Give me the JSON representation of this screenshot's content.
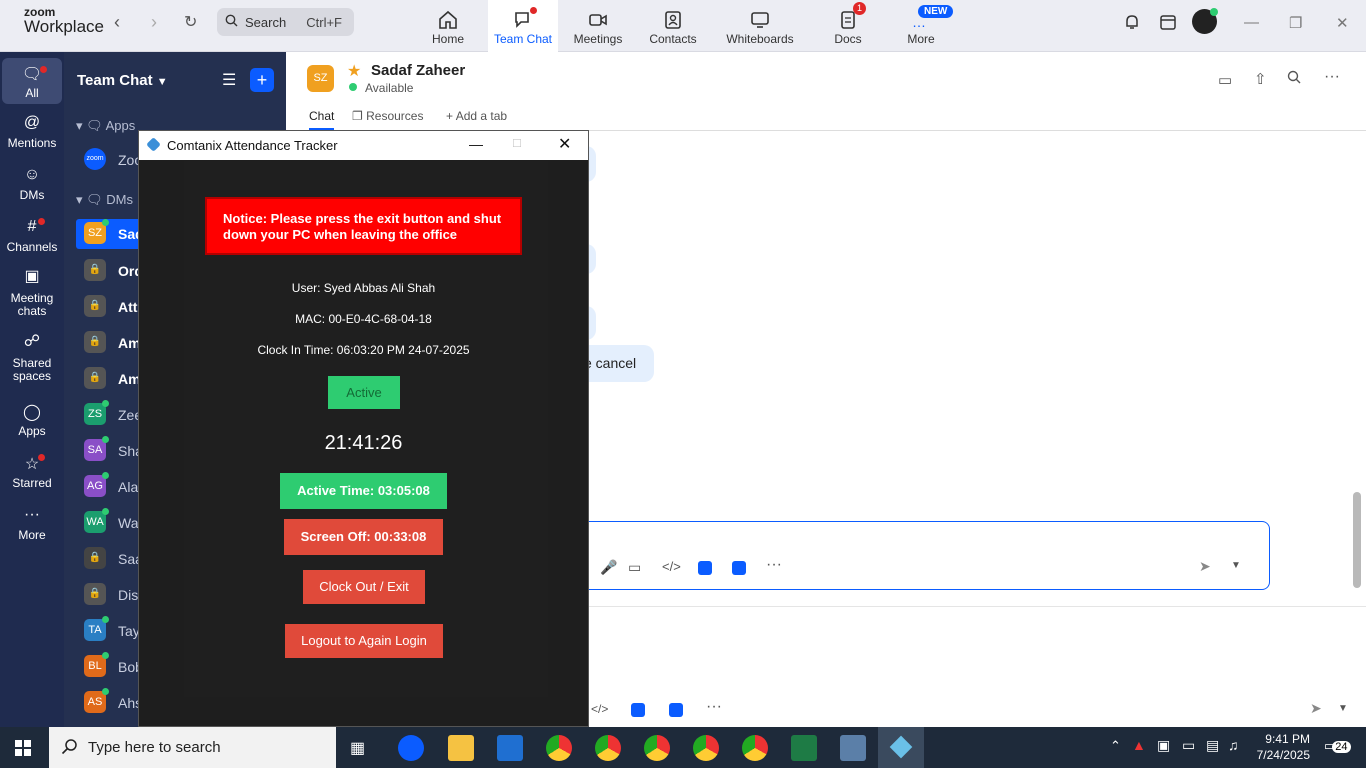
{
  "topbar": {
    "logo_line1": "zoom",
    "logo_line2": "Workplace",
    "search_placeholder": "Search",
    "search_shortcut": "Ctrl+F",
    "nav": [
      {
        "label": "Home"
      },
      {
        "label": "Team Chat"
      },
      {
        "label": "Meetings"
      },
      {
        "label": "Contacts"
      },
      {
        "label": "Whiteboards"
      },
      {
        "label": "Docs",
        "badge": "1"
      },
      {
        "label": "More",
        "badge": "NEW"
      }
    ]
  },
  "rail": [
    {
      "label": "All"
    },
    {
      "label": "Mentions"
    },
    {
      "label": "DMs"
    },
    {
      "label": "Channels"
    },
    {
      "label": "Meeting chats"
    },
    {
      "label": "Shared spaces"
    },
    {
      "label": "Apps"
    },
    {
      "label": "Starred"
    },
    {
      "label": "More"
    }
  ],
  "chatlist": {
    "title": "Team Chat",
    "section_apps": "Apps",
    "section_dms": "DMs",
    "items": [
      {
        "initials": "zoom",
        "label": "Zoo",
        "color": "#0b5cff"
      },
      {
        "initials": "SZ",
        "label": "Sad",
        "color": "#f0a020"
      },
      {
        "initials": "",
        "label": "Ord",
        "color": "#555"
      },
      {
        "initials": "",
        "label": "Att",
        "color": "#555"
      },
      {
        "initials": "",
        "label": "Am",
        "color": "#555"
      },
      {
        "initials": "",
        "label": "Am",
        "color": "#555"
      },
      {
        "initials": "ZS",
        "label": "Zee",
        "color": "#1b9e6e"
      },
      {
        "initials": "SA",
        "label": "Sha",
        "color": "#8a4fc7"
      },
      {
        "initials": "AG",
        "label": "Ala",
        "color": "#8a4fc7"
      },
      {
        "initials": "WA",
        "label": "Wal",
        "color": "#1b9e6e"
      },
      {
        "initials": "",
        "label": "Saa",
        "color": "#444"
      },
      {
        "initials": "",
        "label": "Dis",
        "color": "#555"
      },
      {
        "initials": "TA",
        "label": "Tay",
        "color": "#2a7fc4"
      },
      {
        "initials": "BL",
        "label": "Bob",
        "color": "#e06a1a"
      },
      {
        "initials": "AS",
        "label": "Ahs",
        "color": "#e06a1a"
      }
    ]
  },
  "chat": {
    "avatar_initials": "SZ",
    "name": "Sadaf Zaheer",
    "status": "Available",
    "tabs": [
      "Chat",
      "Resources",
      "Add a tab"
    ],
    "message_fragment": "e cancel"
  },
  "popup": {
    "title": "Comtanix Attendance Tracker",
    "notice": "Notice: Please press the exit button and shut down your PC when leaving the office",
    "user": "User: Syed  Abbas Ali Shah",
    "mac": "MAC: 00-E0-4C-68-04-18",
    "clock_in": "Clock In Time: 06:03:20 PM 24-07-2025",
    "status_btn": "Active",
    "clock": "21:41:26",
    "active_time": "Active Time: 03:05:08",
    "screen_off": "Screen Off: 00:33:08",
    "clock_out": "Clock Out / Exit",
    "logout": "Logout to Again Login"
  },
  "taskbar": {
    "search_placeholder": "Type here to search",
    "time": "9:41 PM",
    "date": "7/24/2025",
    "notif_count": "24"
  },
  "colors": {
    "accent": "#0b5cff",
    "notice_red": "#ff0000",
    "active_green": "#2ecc71",
    "btn_red": "#e04a3a"
  }
}
